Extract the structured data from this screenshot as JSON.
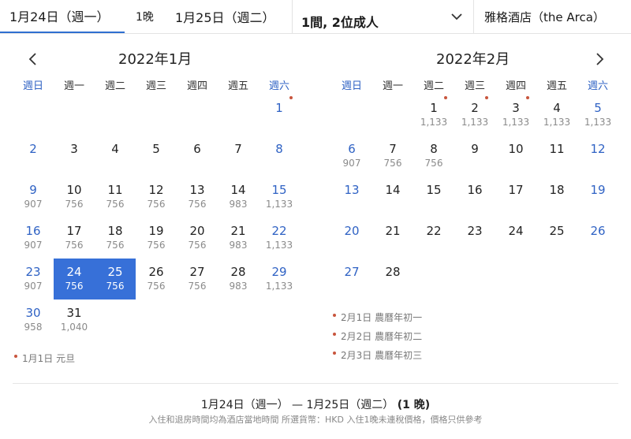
{
  "header": {
    "checkin": "1月24日（週一）",
    "nights": "1晚",
    "checkout": "1月25日（週二）",
    "guests": "1間, 2位成人",
    "hotel": "雅格酒店（the Arca）"
  },
  "weekdays": [
    "週日",
    "週一",
    "週二",
    "週三",
    "週四",
    "週五",
    "週六"
  ],
  "months": [
    {
      "title": "2022年1月",
      "first_weekday": 6,
      "days": [
        {
          "d": "1",
          "p": "",
          "dot": true
        },
        {
          "d": "2",
          "p": ""
        },
        {
          "d": "3",
          "p": ""
        },
        {
          "d": "4",
          "p": ""
        },
        {
          "d": "5",
          "p": ""
        },
        {
          "d": "6",
          "p": ""
        },
        {
          "d": "7",
          "p": ""
        },
        {
          "d": "8",
          "p": ""
        },
        {
          "d": "9",
          "p": "907"
        },
        {
          "d": "10",
          "p": "756"
        },
        {
          "d": "11",
          "p": "756"
        },
        {
          "d": "12",
          "p": "756"
        },
        {
          "d": "13",
          "p": "756"
        },
        {
          "d": "14",
          "p": "983"
        },
        {
          "d": "15",
          "p": "1,133"
        },
        {
          "d": "16",
          "p": "907"
        },
        {
          "d": "17",
          "p": "756"
        },
        {
          "d": "18",
          "p": "756"
        },
        {
          "d": "19",
          "p": "756"
        },
        {
          "d": "20",
          "p": "756"
        },
        {
          "d": "21",
          "p": "983"
        },
        {
          "d": "22",
          "p": "1,133"
        },
        {
          "d": "23",
          "p": "907"
        },
        {
          "d": "24",
          "p": "756",
          "sel": true
        },
        {
          "d": "25",
          "p": "756",
          "sel": true
        },
        {
          "d": "26",
          "p": "756"
        },
        {
          "d": "27",
          "p": "756"
        },
        {
          "d": "28",
          "p": "983"
        },
        {
          "d": "29",
          "p": "1,133"
        },
        {
          "d": "30",
          "p": "958"
        },
        {
          "d": "31",
          "p": "1,040"
        }
      ],
      "holidays": [
        "1月1日 元旦"
      ]
    },
    {
      "title": "2022年2月",
      "first_weekday": 2,
      "days": [
        {
          "d": "1",
          "p": "1,133",
          "dot": true
        },
        {
          "d": "2",
          "p": "1,133",
          "dot": true
        },
        {
          "d": "3",
          "p": "1,133",
          "dot": true
        },
        {
          "d": "4",
          "p": "1,133"
        },
        {
          "d": "5",
          "p": "1,133"
        },
        {
          "d": "6",
          "p": "907"
        },
        {
          "d": "7",
          "p": "756"
        },
        {
          "d": "8",
          "p": "756"
        },
        {
          "d": "9",
          "p": ""
        },
        {
          "d": "10",
          "p": ""
        },
        {
          "d": "11",
          "p": ""
        },
        {
          "d": "12",
          "p": ""
        },
        {
          "d": "13",
          "p": ""
        },
        {
          "d": "14",
          "p": ""
        },
        {
          "d": "15",
          "p": ""
        },
        {
          "d": "16",
          "p": ""
        },
        {
          "d": "17",
          "p": ""
        },
        {
          "d": "18",
          "p": ""
        },
        {
          "d": "19",
          "p": ""
        },
        {
          "d": "20",
          "p": ""
        },
        {
          "d": "21",
          "p": ""
        },
        {
          "d": "22",
          "p": ""
        },
        {
          "d": "23",
          "p": ""
        },
        {
          "d": "24",
          "p": ""
        },
        {
          "d": "25",
          "p": ""
        },
        {
          "d": "26",
          "p": ""
        },
        {
          "d": "27",
          "p": ""
        },
        {
          "d": "28",
          "p": ""
        }
      ],
      "holidays": [
        "2月1日 農曆年初一",
        "2月2日 農曆年初二",
        "2月3日 農曆年初三"
      ]
    }
  ],
  "summary": {
    "range": "1月24日（週一） — 1月25日（週二）",
    "nights": "(1 晚)",
    "note": "入住和退房時間均為酒店當地時間 所選貨幣：HKD 入住1晚未連稅價格，價格只供參考"
  }
}
